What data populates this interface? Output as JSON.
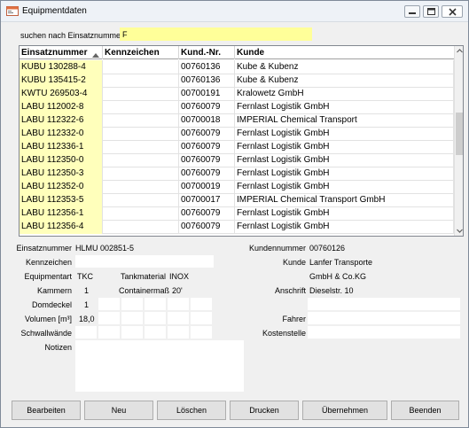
{
  "window": {
    "title": "Equipmentdaten"
  },
  "search": {
    "label": "suchen nach Einsatznummer:",
    "value": "F"
  },
  "grid": {
    "columns": [
      "Einsatznummer",
      "Kennzeichen",
      "Kund.-Nr.",
      "Kunde"
    ],
    "rows": [
      [
        "KUBU 130288-4",
        "",
        "00760136",
        "Kube & Kubenz"
      ],
      [
        "KUBU 135415-2",
        "",
        "00760136",
        "Kube & Kubenz"
      ],
      [
        "KWTU 269503-4",
        "",
        "00700191",
        "Kralowetz GmbH"
      ],
      [
        "LABU 112002-8",
        "",
        "00760079",
        "Fernlast Logistik GmbH"
      ],
      [
        "LABU 112322-6",
        "",
        "00700018",
        "IMPERIAL Chemical Transport"
      ],
      [
        "LABU 112332-0",
        "",
        "00760079",
        "Fernlast Logistik GmbH"
      ],
      [
        "LABU 112336-1",
        "",
        "00760079",
        "Fernlast Logistik GmbH"
      ],
      [
        "LABU 112350-0",
        "",
        "00760079",
        "Fernlast Logistik GmbH"
      ],
      [
        "LABU 112350-3",
        "",
        "00760079",
        "Fernlast Logistik GmbH"
      ],
      [
        "LABU 112352-0",
        "",
        "00700019",
        "Fernlast Logistik GmbH"
      ],
      [
        "LABU 112353-5",
        "",
        "00700017",
        "IMPERIAL Chemical Transport GmbH"
      ],
      [
        "LABU 112356-1",
        "",
        "00760079",
        "Fernlast Logistik GmbH"
      ],
      [
        "LABU 112356-4",
        "",
        "00760079",
        "Fernlast Logistik GmbH"
      ]
    ]
  },
  "detail": {
    "einsatznummer_label": "Einsatznummer",
    "einsatznummer_value": "HLMU 002851-5",
    "kennzeichen_label": "Kennzeichen",
    "equipmentart_label": "Equipmentart",
    "equipmentart_value": "TKC",
    "tankmaterial_label": "Tankmaterial",
    "tankmaterial_value": "INOX",
    "kammern_label": "Kammern",
    "kammern_value": "1",
    "containermass_label": "Containermaß",
    "containermass_value": "20'",
    "domdeckel_label": "Domdeckel",
    "domdeckel_value": "1",
    "volumen_label": "Volumen [m³]",
    "volumen_value": "18,0",
    "schwallwaende_label": "Schwallwände",
    "notizen_label": "Notizen",
    "kundennummer_label": "Kundennummer",
    "kundennummer_value": "00760126",
    "kunde_label": "Kunde",
    "kunde_value_1": "Lanfer Transporte",
    "kunde_value_2": "GmbH & Co.KG",
    "anschrift_label": "Anschrift",
    "anschrift_value": "Dieselstr. 10",
    "fahrer_label": "Fahrer",
    "kostenstelle_label": "Kostenstelle"
  },
  "buttons": {
    "bearbeiten": "Bearbeiten",
    "neu": "Neu",
    "loeschen": "Löschen",
    "drucken": "Drucken",
    "uebernehmen": "Übernehmen",
    "beenden": "Beenden"
  },
  "colors": {
    "search_bg": "#ffff99",
    "key_column_bg": "#ffffbb"
  }
}
